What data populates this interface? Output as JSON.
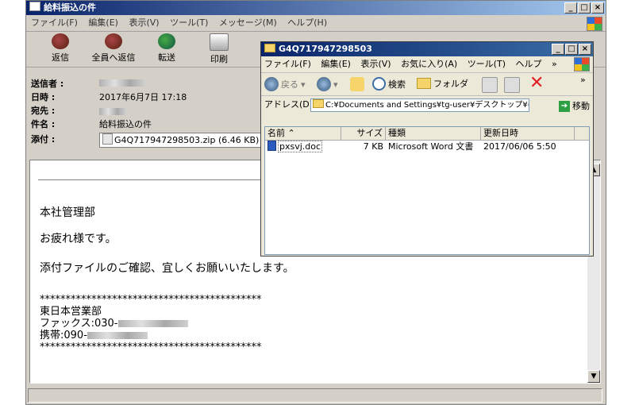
{
  "mail": {
    "title": "給料振込の件",
    "menu": [
      "ファイル(F)",
      "編集(E)",
      "表示(V)",
      "ツール(T)",
      "メッセージ(M)",
      "ヘルプ(H)"
    ],
    "toolbar": [
      "返信",
      "全員へ返信",
      "転送",
      "印刷"
    ],
    "headers": {
      "from_label": "送信者 :",
      "date_label": "日時 :",
      "date_value": "2017年6月7日 17:18",
      "to_label": "宛先 :",
      "subject_label": "件名 :",
      "subject_value": "給料振込の件",
      "attach_label": "添付 :",
      "attach_value": "G4Q717947298503.zip (6.46 KB)"
    },
    "body": {
      "line1": "本社管理部",
      "line2": "お疲れ様です。",
      "line3": "添付ファイルのご確認、宜しくお願いいたします。",
      "stars": "*******************************************",
      "sig_dept": "東日本営業部",
      "sig_fax": "ファックス:030-",
      "sig_mobile": "携帯:090-"
    }
  },
  "explorer": {
    "title": "G4Q717947298503",
    "menu": [
      "ファイル(F)",
      "編集(E)",
      "表示(V)",
      "お気に入り(A)",
      "ツール(T)",
      "ヘルプ"
    ],
    "toolbar": {
      "back": "戻る",
      "search": "検索",
      "folder": "フォルダ"
    },
    "address_label": "アドレス(D)",
    "address_value": "C:¥Documents and Settings¥tg-user¥デスクトップ¥(",
    "go_label": "移動",
    "columns": [
      "名前",
      "サイズ",
      "種類",
      "更新日時"
    ],
    "files": [
      {
        "name": "pxsvj.doc",
        "size": "7 KB",
        "type": "Microsoft Word 文書",
        "modified": "2017/06/06 5:50"
      }
    ]
  }
}
